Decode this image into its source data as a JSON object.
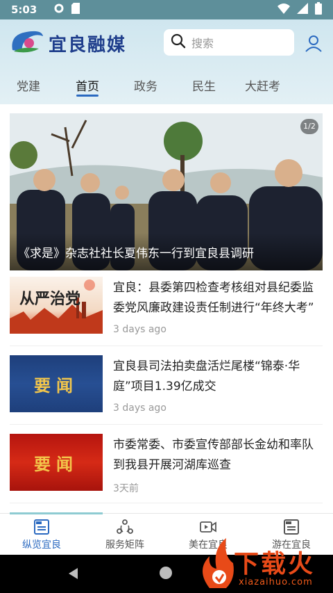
{
  "status_bar": {
    "time": "5:03"
  },
  "header": {
    "logo_text": "宜良融媒",
    "search_placeholder": "搜索"
  },
  "nav_tabs": [
    {
      "label": "党建",
      "active": false
    },
    {
      "label": "首页",
      "active": true
    },
    {
      "label": "政务",
      "active": false
    },
    {
      "label": "民生",
      "active": false
    },
    {
      "label": "大赶考",
      "active": false
    }
  ],
  "hero": {
    "caption": "《求是》杂志社社长夏伟东一行到宜良县调研",
    "counter": "1/2"
  },
  "news": [
    {
      "title": "宜良：县委第四检查考核组对县纪委监委党风廉政建设责任制进行“年终大考”",
      "time": "3 days ago",
      "thumb_type": "cover",
      "thumb_text": "从严治党"
    },
    {
      "title": "宜良县司法拍卖盘活烂尾楼“锦泰·华庭”项目1.39亿成交",
      "time": "3 days ago",
      "thumb_type": "blue",
      "thumb_text": "要闻"
    },
    {
      "title": "市委常委、市委宣传部部长金幼和率队到我县开展河湖库巡查",
      "time": "3天前",
      "thumb_type": "red",
      "thumb_text": "要闻"
    }
  ],
  "bottom_nav": [
    {
      "label": "纵览宜良",
      "icon": "news-icon",
      "active": true
    },
    {
      "label": "服务矩阵",
      "icon": "service-icon",
      "active": false
    },
    {
      "label": "美在宜良",
      "icon": "video-icon",
      "active": false
    },
    {
      "label": "游在宜良",
      "icon": "news-icon",
      "active": false
    }
  ],
  "watermark": {
    "text": "下载火",
    "url": "xiazaihuo.com"
  },
  "colors": {
    "accent": "#2a69c0",
    "status_bar": "#5e8f9a",
    "watermark": "#e84a18"
  }
}
